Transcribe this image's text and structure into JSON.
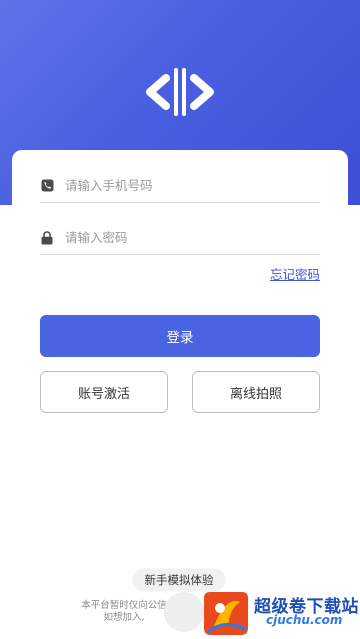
{
  "header": {
    "logo_icon": "code-brackets-logo",
    "brand_color": "#4a5fe0"
  },
  "form": {
    "phone": {
      "placeholder": "请输入手机号码",
      "icon": "phone-icon"
    },
    "password": {
      "placeholder": "请输入密码",
      "icon": "lock-icon"
    },
    "forgot_label": "忘记密码"
  },
  "actions": {
    "login_label": "登录",
    "activate_label": "账号激活",
    "offline_label": "离线拍照"
  },
  "footer": {
    "trial_label": "新手模拟体验",
    "notice_line1": "本平台暂时仅向公信",
    "notice_line2": "如想加入,"
  },
  "watermark": {
    "text": "超级卷下载站",
    "url": "cjuchu.com"
  },
  "colors": {
    "primary": "#4a63e1",
    "link": "#3f56d8"
  }
}
